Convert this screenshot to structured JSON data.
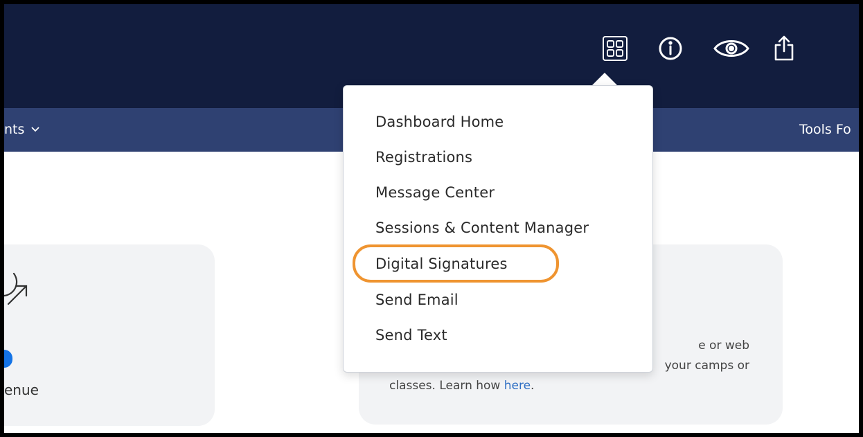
{
  "topbar": {
    "icons": [
      "dashboard-grid-icon",
      "info-icon",
      "eye-icon",
      "share-icon"
    ]
  },
  "navbar": {
    "left_label": "nts",
    "right_label": "Tools Fo"
  },
  "dropdown": {
    "items": [
      {
        "label": "Dashboard Home"
      },
      {
        "label": "Registrations"
      },
      {
        "label": "Message Center"
      },
      {
        "label": "Sessions & Content Manager"
      },
      {
        "label": "Digital Signatures",
        "highlighted": true
      },
      {
        "label": "Send Email"
      },
      {
        "label": "Send Text"
      }
    ]
  },
  "cards": {
    "left": {
      "label": "enue"
    },
    "right": {
      "line1": "e or web",
      "line2": "your camps or",
      "line3_text": "classes. Learn how ",
      "line3_link": "here",
      "line3_end": "."
    }
  },
  "colors": {
    "topbar": "#121d3e",
    "navbar": "#2f4172",
    "highlight": "#ef9430",
    "link": "#2f6fc4"
  }
}
